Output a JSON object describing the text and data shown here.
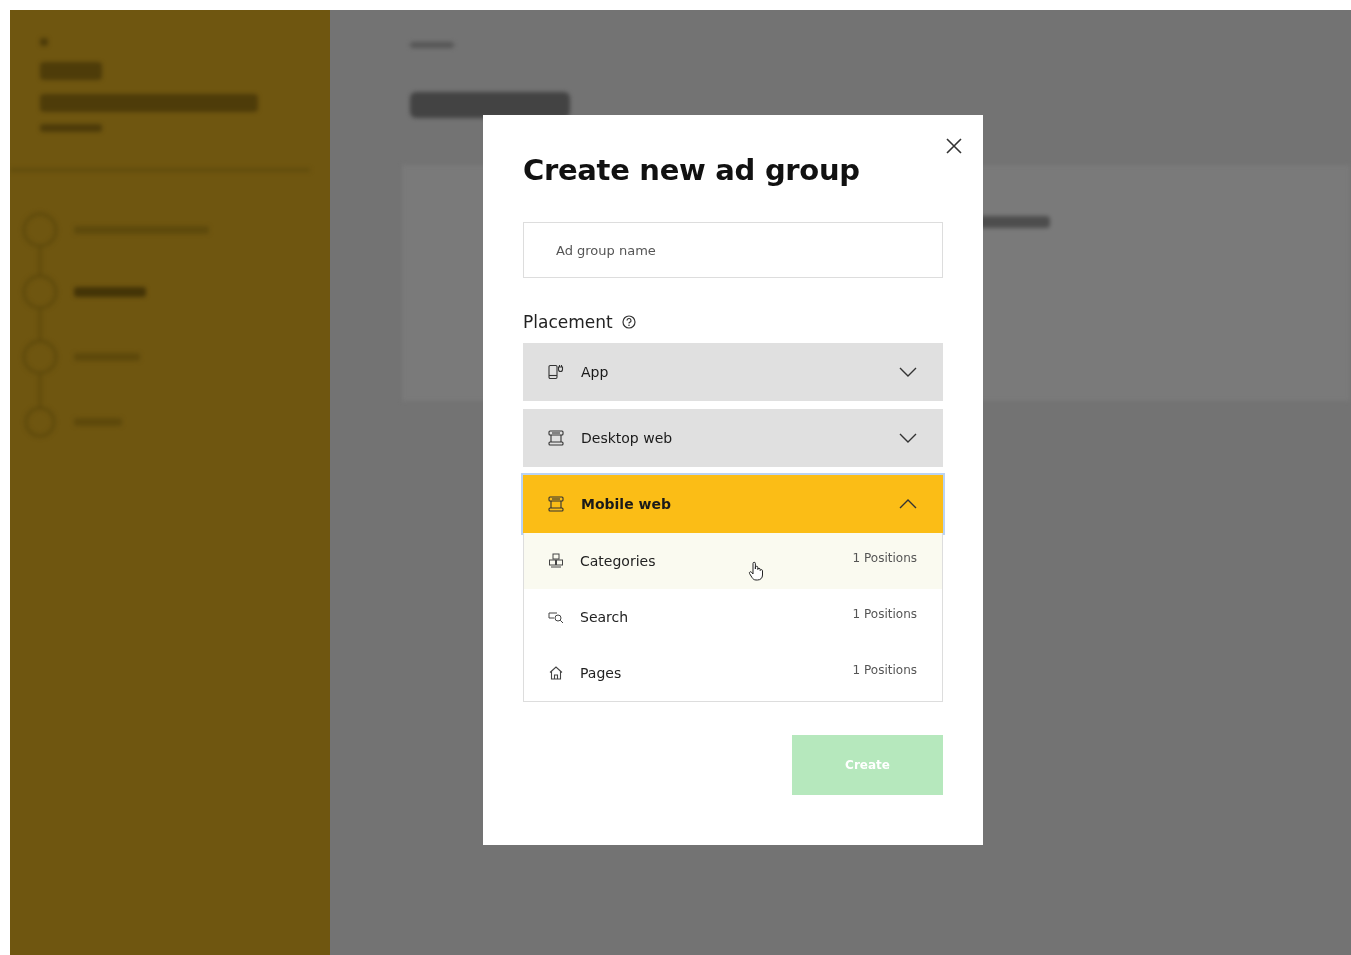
{
  "dialog": {
    "title": "Create new ad group",
    "name_field": {
      "placeholder": "Ad group name"
    },
    "placement_label": "Placement",
    "placements": [
      {
        "label": "App",
        "kind": "app",
        "selected": false,
        "expanded": false
      },
      {
        "label": "Desktop web",
        "kind": "desktop",
        "selected": false,
        "expanded": false
      },
      {
        "label": "Mobile web",
        "kind": "mobile",
        "selected": true,
        "expanded": true,
        "options": [
          {
            "label": "Categories",
            "kind": "categories",
            "positions": "1 Positions",
            "hovered": true
          },
          {
            "label": "Search",
            "kind": "search",
            "positions": "1 Positions",
            "hovered": false
          },
          {
            "label": "Pages",
            "kind": "pages",
            "positions": "1 Positions",
            "hovered": false
          }
        ]
      }
    ],
    "create_button": {
      "label": "Create",
      "disabled": true
    }
  }
}
